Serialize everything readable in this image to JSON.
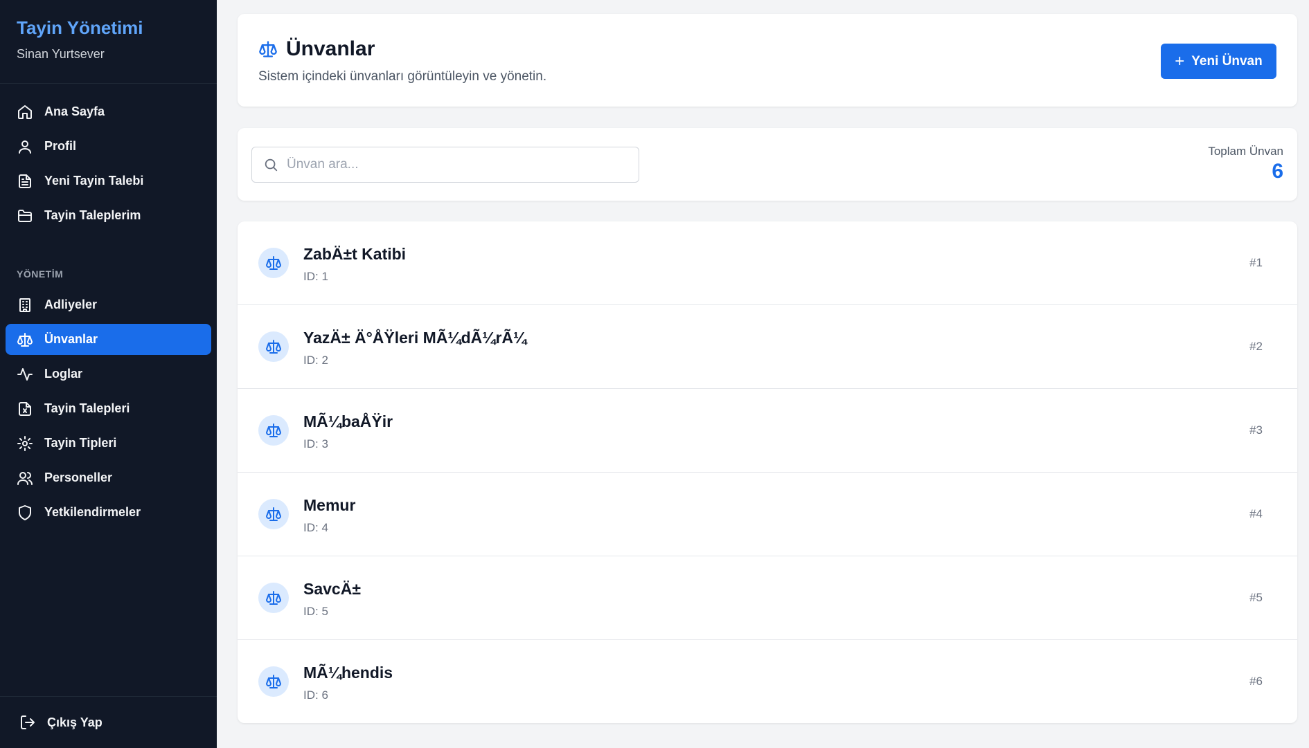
{
  "app": {
    "title": "Tayin Yönetimi",
    "user": "Sinan Yurtsever"
  },
  "nav": {
    "items": [
      {
        "label": "Ana Sayfa",
        "icon": "home-icon"
      },
      {
        "label": "Profil",
        "icon": "user-icon"
      },
      {
        "label": "Yeni Tayin Talebi",
        "icon": "document-icon"
      },
      {
        "label": "Tayin Taleplerim",
        "icon": "folder-icon"
      }
    ],
    "section_label": "YÖNETİM",
    "admin_items": [
      {
        "label": "Adliyeler",
        "icon": "building-icon"
      },
      {
        "label": "Ünvanlar",
        "icon": "scale-icon",
        "active": true
      },
      {
        "label": "Loglar",
        "icon": "activity-icon"
      },
      {
        "label": "Tayin Talepleri",
        "icon": "file-x-icon"
      },
      {
        "label": "Tayin Tipleri",
        "icon": "gear-icon"
      },
      {
        "label": "Personeller",
        "icon": "users-icon"
      },
      {
        "label": "Yetkilendirmeler",
        "icon": "shield-icon"
      }
    ],
    "logout_label": "Çıkış Yap"
  },
  "header": {
    "title": "Ünvanlar",
    "subtitle": "Sistem içindeki ünvanları görüntüleyin ve yönetin.",
    "new_button_label": "Yeni Ünvan"
  },
  "search": {
    "placeholder": "Ünvan ara...",
    "value": ""
  },
  "total": {
    "label": "Toplam Ünvan",
    "value": "6"
  },
  "titles": [
    {
      "name": "ZabÄ±t Katibi",
      "id_text": "ID: 1",
      "number": "#1"
    },
    {
      "name": "YazÄ± Ä°ÅŸleri MÃ¼dÃ¼rÃ¼",
      "id_text": "ID: 2",
      "number": "#2"
    },
    {
      "name": "MÃ¼baÅŸir",
      "id_text": "ID: 3",
      "number": "#3"
    },
    {
      "name": "Memur",
      "id_text": "ID: 4",
      "number": "#4"
    },
    {
      "name": "SavcÄ±",
      "id_text": "ID: 5",
      "number": "#5"
    },
    {
      "name": "MÃ¼hendis",
      "id_text": "ID: 6",
      "number": "#6"
    }
  ],
  "colors": {
    "accent": "#1a6dea",
    "sidebar_bg": "#111827",
    "brand": "#60a5fa",
    "page_bg": "#f3f4f6"
  }
}
